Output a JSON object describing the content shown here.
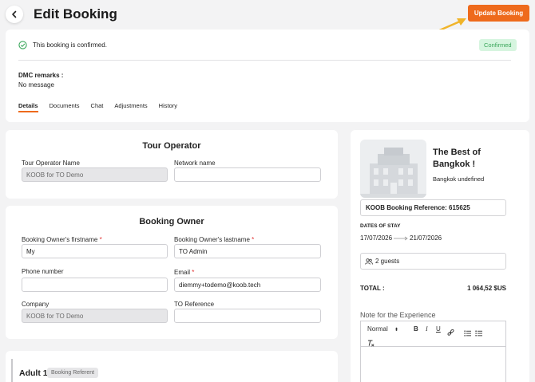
{
  "header": {
    "title": "Edit Booking",
    "update_label": "Update Booking"
  },
  "status": {
    "message": "This booking is confirmed.",
    "badge": "Confirmed"
  },
  "remarks": {
    "title": "DMC remarks :",
    "text": "No message"
  },
  "tabs": [
    "Details",
    "Documents",
    "Chat",
    "Adjustments",
    "History"
  ],
  "tour_operator": {
    "title": "Tour Operator",
    "name_label": "Tour Operator Name",
    "name_value": "KOOB for TO Demo",
    "network_label": "Network name",
    "network_value": ""
  },
  "owner": {
    "title": "Booking Owner",
    "firstname_label": "Booking Owner's firstname",
    "firstname_value": "My",
    "lastname_label": "Booking Owner's lastname",
    "lastname_value": "TO Admin",
    "phone_label": "Phone number",
    "phone_value": "",
    "email_label": "Email",
    "email_value": "diemmy+todemo@koob.tech",
    "company_label": "Company",
    "company_value": "KOOB for TO Demo",
    "ref_label": "TO Reference",
    "ref_value": "",
    "required_mark": "*"
  },
  "adult": {
    "title": "Adult 1",
    "badge": "Booking Referent"
  },
  "summary": {
    "product_title": "The Best of Bangkok !",
    "location": "Bangkok undefined",
    "reference": "KOOB Booking Reference: 615625",
    "dates_label": "DATES OF STAY",
    "date_from": "17/07/2026",
    "date_to": "21/07/2026",
    "guests": "2 guests",
    "total_label": "TOTAL :",
    "total_value": "1 064,52 $US",
    "note_label": "Note for the Experience",
    "format_option": "Normal"
  },
  "colors": {
    "accent": "#ee6a1c",
    "confirmed_bg": "#d6f5df",
    "confirmed_text": "#3aa65a",
    "arrow": "#f0b429"
  }
}
